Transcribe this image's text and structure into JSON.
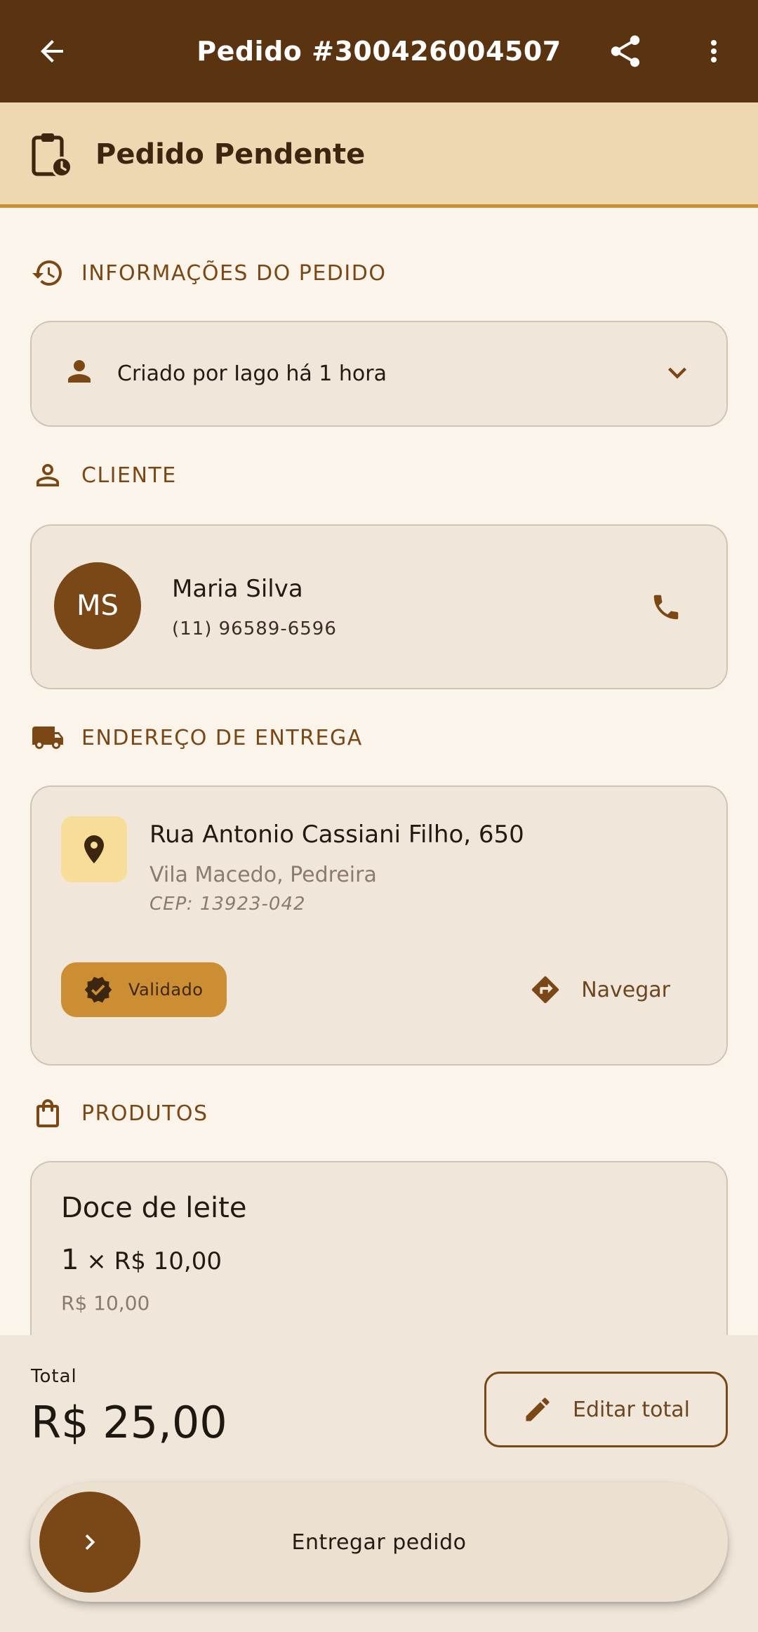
{
  "app_bar": {
    "title": "Pedido #300426004507",
    "back_icon": "arrow-back-icon",
    "share_icon": "share-icon",
    "more_icon": "more-vert-icon"
  },
  "status": {
    "label": "Pedido Pendente",
    "icon": "clipboard-clock-icon"
  },
  "sections": {
    "order_info": {
      "label": "INFORMAÇÕES DO PEDIDO",
      "icon": "history-icon"
    },
    "client": {
      "label": "CLIENTE",
      "icon": "person-outline-icon"
    },
    "delivery": {
      "label": "ENDEREÇO DE ENTREGA",
      "icon": "truck-icon"
    },
    "products": {
      "label": "PRODUTOS",
      "icon": "shopping-bag-icon"
    }
  },
  "order_info": {
    "created_text": "Criado por Iago há 1 hora"
  },
  "client": {
    "initials": "MS",
    "name": "Maria Silva",
    "phone": "(11) 96589-6596"
  },
  "address": {
    "street": "Rua Antonio Cassiani Filho, 650",
    "city": "Vila Macedo, Pedreira",
    "cep": "CEP: 13923-042",
    "validated_label": "Validado",
    "navigate_label": "Navegar"
  },
  "products": [
    {
      "name": "Doce de leite",
      "qty": "1",
      "times": "×",
      "unit_price": "R$ 10,00",
      "subtotal": "R$ 10,00"
    }
  ],
  "footer": {
    "total_label": "Total",
    "total_value": "R$ 25,00",
    "edit_total_label": "Editar total",
    "slide_label": "Entregar pedido"
  },
  "colors": {
    "primary": "#5A3311",
    "accent": "#CC8E32",
    "banner": "#EDD8B2",
    "background": "#FBF4EA",
    "card": "#F0E6D9"
  }
}
